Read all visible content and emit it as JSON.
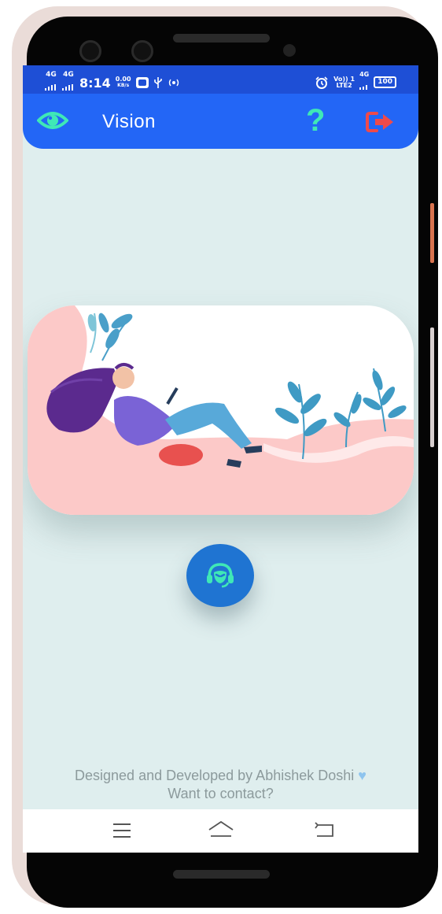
{
  "statusbar": {
    "signal1": "4G",
    "signal2": "4G",
    "time": "8:14",
    "speed_value": "0.00",
    "speed_unit": "KB/s",
    "volte": "Vo)) 1",
    "lte": "LTE2",
    "net": "4G",
    "battery": "100"
  },
  "appbar": {
    "title": "Vision",
    "colors": {
      "bar": "#2366f6",
      "eye": "#3fe8b6",
      "help": "#3fe8b6",
      "logout": "#ef4a4a"
    }
  },
  "footer": {
    "credit_line": "Designed and Developed by Abhishek Doshi",
    "contact_line": "Want to contact?"
  },
  "icons": {
    "appbar_left": "eye-icon",
    "appbar_help": "help-icon",
    "appbar_logout": "logout-icon",
    "fab": "headset-icon",
    "nav": [
      "menu-icon",
      "home-icon",
      "back-icon"
    ]
  }
}
